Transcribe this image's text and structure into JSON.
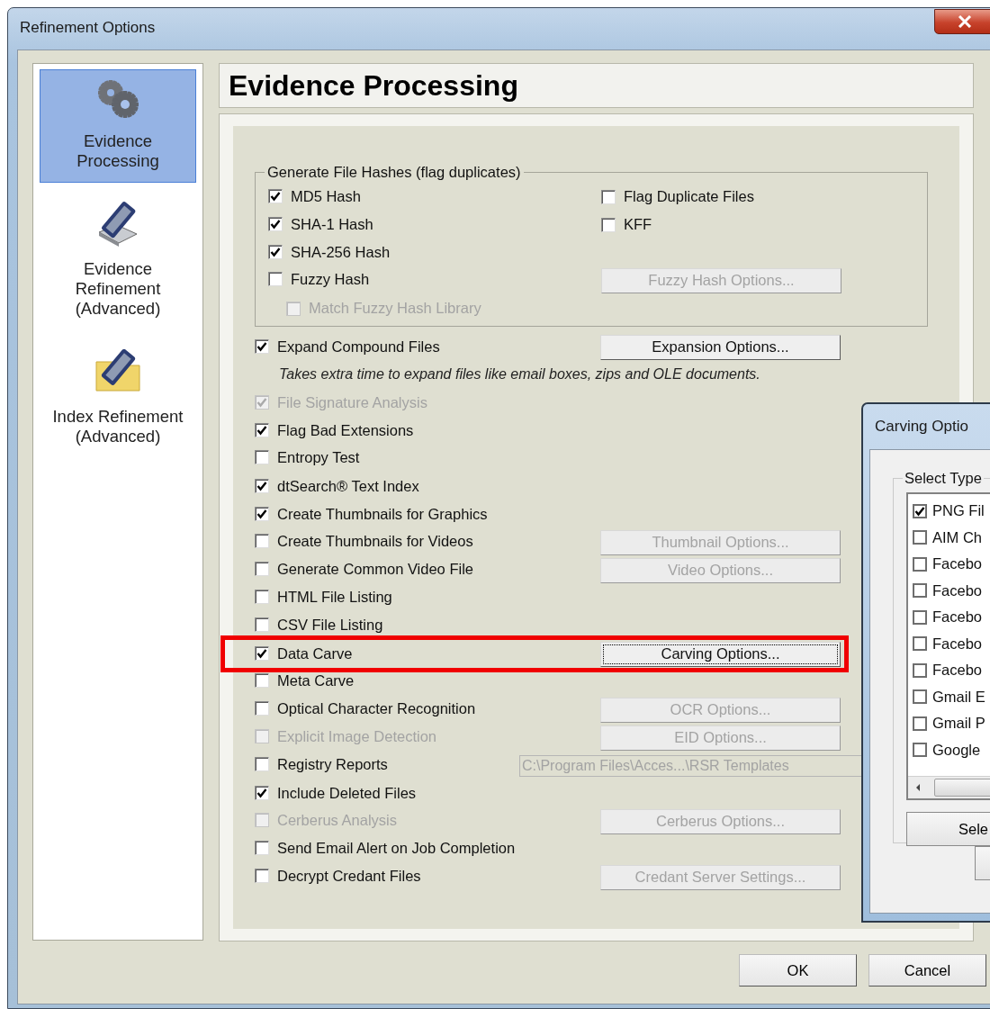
{
  "window": {
    "title": "Refinement Options"
  },
  "sidebar": {
    "items": [
      {
        "label": "Evidence Processing",
        "selected": true,
        "kind": "gears"
      },
      {
        "label": "Evidence Refinement (Advanced)",
        "selected": false,
        "kind": "scanner"
      },
      {
        "label": "Index Refinement (Advanced)",
        "selected": false,
        "kind": "folder"
      }
    ]
  },
  "header": {
    "title": "Evidence Processing"
  },
  "hash_group": {
    "title": "Generate File Hashes (flag duplicates)",
    "rows": [
      {
        "option": {
          "label": "MD5 Hash",
          "checked": true,
          "disabled": false
        },
        "right": {
          "kind": "checkbox",
          "label": "Flag Duplicate Files",
          "checked": false,
          "disabled": false
        }
      },
      {
        "option": {
          "label": "SHA-1 Hash",
          "checked": true,
          "disabled": false
        },
        "right": {
          "kind": "checkbox",
          "label": "KFF",
          "checked": false,
          "disabled": false
        }
      },
      {
        "option": {
          "label": "SHA-256 Hash",
          "checked": true,
          "disabled": false
        }
      },
      {
        "option": {
          "label": "Fuzzy Hash",
          "checked": false,
          "disabled": false,
          "children": [
            {
              "label": "Match Fuzzy Hash Library",
              "checked": false,
              "disabled": true
            }
          ]
        },
        "right": {
          "kind": "button",
          "label": "Fuzzy Hash Options...",
          "disabled": true,
          "focused": false
        }
      }
    ]
  },
  "options": [
    {
      "label": "Expand Compound Files",
      "checked": true,
      "disabled": false,
      "highlighted": false,
      "right": {
        "kind": "button",
        "label": "Expansion Options...",
        "disabled": false,
        "focused": false
      },
      "note": "Takes extra time to expand files like email boxes, zips and OLE documents."
    },
    {
      "label": "File Signature Analysis",
      "checked": true,
      "disabled": true,
      "highlighted": false
    },
    {
      "label": "Flag Bad Extensions",
      "checked": true,
      "disabled": false,
      "highlighted": false
    },
    {
      "label": "Entropy Test",
      "checked": false,
      "disabled": false,
      "highlighted": false
    },
    {
      "label": "dtSearch® Text Index",
      "checked": true,
      "disabled": false,
      "highlighted": false
    },
    {
      "label": "Create Thumbnails for Graphics",
      "checked": true,
      "disabled": false,
      "highlighted": false
    },
    {
      "label": "Create Thumbnails for Videos",
      "checked": false,
      "disabled": false,
      "highlighted": false,
      "right": {
        "kind": "button",
        "label": "Thumbnail Options...",
        "disabled": true,
        "focused": false
      }
    },
    {
      "label": "Generate Common Video File",
      "checked": false,
      "disabled": false,
      "highlighted": false,
      "right": {
        "kind": "button",
        "label": "Video Options...",
        "disabled": true,
        "focused": false
      }
    },
    {
      "label": "HTML File Listing",
      "checked": false,
      "disabled": false,
      "highlighted": false
    },
    {
      "label": "CSV File Listing",
      "checked": false,
      "disabled": false,
      "highlighted": false
    },
    {
      "label": "Data Carve",
      "checked": true,
      "disabled": false,
      "highlighted": true,
      "right": {
        "kind": "button",
        "label": "Carving Options...",
        "disabled": false,
        "focused": true
      }
    },
    {
      "label": "Meta Carve",
      "checked": false,
      "disabled": false,
      "highlighted": false
    },
    {
      "label": "Optical Character Recognition",
      "checked": false,
      "disabled": false,
      "highlighted": false,
      "right": {
        "kind": "button",
        "label": "OCR Options...",
        "disabled": true,
        "focused": false
      }
    },
    {
      "label": "Explicit Image Detection",
      "checked": false,
      "disabled": true,
      "highlighted": false,
      "right": {
        "kind": "button",
        "label": "EID Options...",
        "disabled": true,
        "focused": false
      }
    },
    {
      "label": "Registry Reports",
      "checked": false,
      "disabled": false,
      "highlighted": false,
      "right": {
        "kind": "path_field",
        "value": "C:\\Program Files\\Acces...\\RSR Templates",
        "disabled": true
      }
    },
    {
      "label": "Include Deleted Files",
      "checked": true,
      "disabled": false,
      "highlighted": false
    },
    {
      "label": "Cerberus Analysis",
      "checked": false,
      "disabled": true,
      "highlighted": false,
      "right": {
        "kind": "button",
        "label": "Cerberus Options...",
        "disabled": true,
        "focused": false
      }
    },
    {
      "label": "Send Email Alert on Job Completion",
      "checked": false,
      "disabled": false,
      "highlighted": false
    },
    {
      "label": "Decrypt Credant Files",
      "checked": false,
      "disabled": false,
      "highlighted": false,
      "right": {
        "kind": "button",
        "label": "Credant Server Settings...",
        "disabled": true,
        "focused": false
      }
    }
  ],
  "footer": {
    "buttons": [
      "OK",
      "Cancel"
    ]
  },
  "carving_dialog": {
    "title": "Carving Optio",
    "group": "Select Type",
    "items": [
      {
        "label": "PNG Fil",
        "checked": true
      },
      {
        "label": "AIM Ch",
        "checked": false
      },
      {
        "label": "Facebo",
        "checked": false
      },
      {
        "label": "Facebo",
        "checked": false
      },
      {
        "label": "Facebo",
        "checked": false
      },
      {
        "label": "Facebo",
        "checked": false
      },
      {
        "label": "Facebo",
        "checked": false
      },
      {
        "label": "Gmail E",
        "checked": false
      },
      {
        "label": "Gmail P",
        "checked": false
      },
      {
        "label": "Google",
        "checked": false
      }
    ],
    "button": "Sele"
  }
}
